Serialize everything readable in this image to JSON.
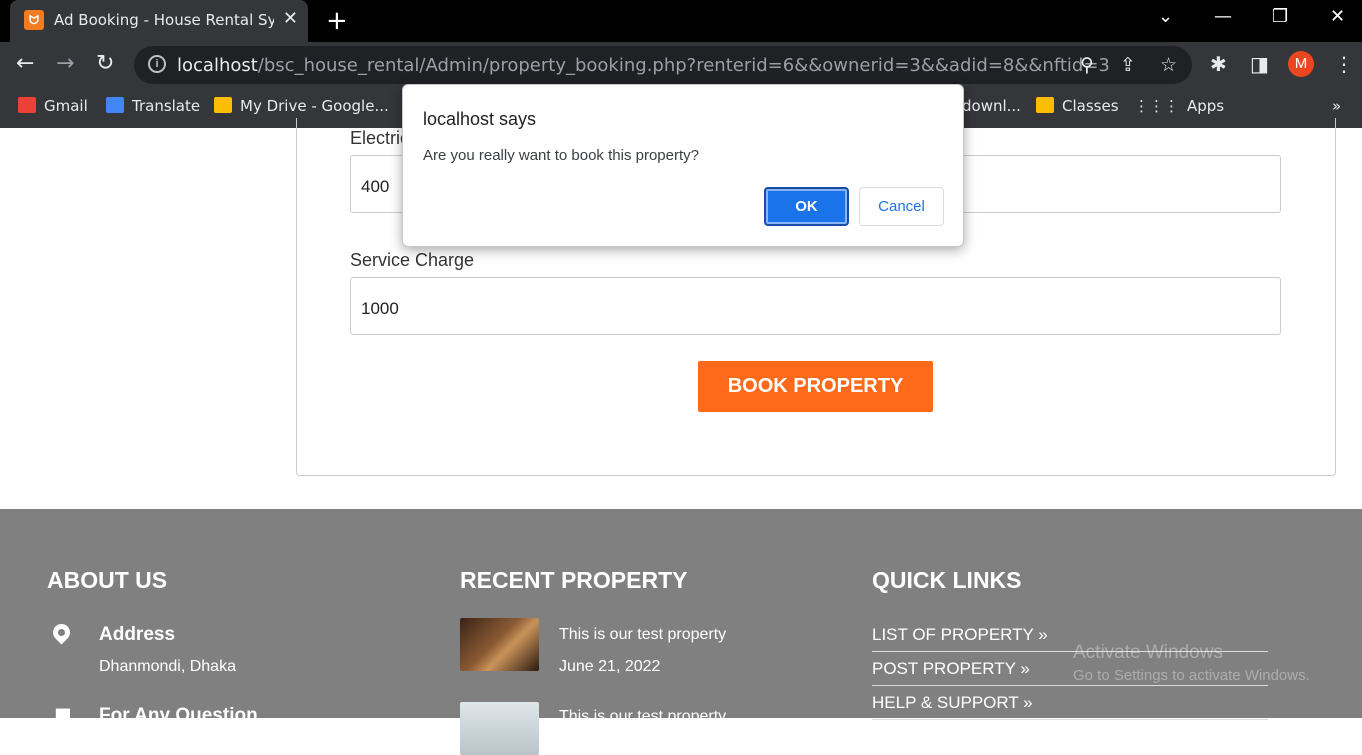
{
  "browser": {
    "tab_title": "Ad Booking - House Rental System",
    "favicon_text": "ᗢ",
    "close_tab": "✕",
    "new_tab": "+",
    "url_host": "localhost",
    "url_path": "/bsc_house_rental/Admin/property_booking.php?renterid=6&&ownerid=3&&adid=8&&nftid=3",
    "avatar": "M"
  },
  "bookmarks": [
    {
      "label": "Gmail",
      "icon": "gmail-icon",
      "color": "#ea4335"
    },
    {
      "label": "Translate",
      "icon": "translate-icon",
      "color": "#4285f4"
    },
    {
      "label": "My Drive - Google...",
      "icon": "drive-icon",
      "color": "#fbbc04"
    },
    {
      "label": "downl...",
      "icon": "bookmark-icon",
      "color": "#f29900"
    },
    {
      "label": "Classes",
      "icon": "classes-icon",
      "color": "#fbbc04"
    },
    {
      "label": "Apps",
      "icon": "apps-grid-icon",
      "color": "#e8eaed"
    }
  ],
  "form": {
    "electricity_label": "Electric",
    "electricity_value": "400",
    "service_label": "Service Charge",
    "service_value": "1000",
    "book_button": "BOOK PROPERTY"
  },
  "dialog": {
    "title": "localhost says",
    "message": "Are you really want to book this property?",
    "ok": "OK",
    "cancel": "Cancel"
  },
  "footer": {
    "about_heading": "ABOUT US",
    "address_label": "Address",
    "address_value": "Dhanmondi, Dhaka",
    "question_label": "For Any Question",
    "recent_heading": "RECENT PROPERTY",
    "recent_items": [
      {
        "title": "This is our test property",
        "date": "June 21, 2022"
      },
      {
        "title": "This is our test property"
      }
    ],
    "quick_heading": "QUICK LINKS",
    "quick_links": [
      "LIST OF PROPERTY »",
      "POST PROPERTY »",
      "HELP & SUPPORT »"
    ]
  },
  "watermark": {
    "line1": "Activate Windows",
    "line2": "Go to Settings to activate Windows."
  }
}
